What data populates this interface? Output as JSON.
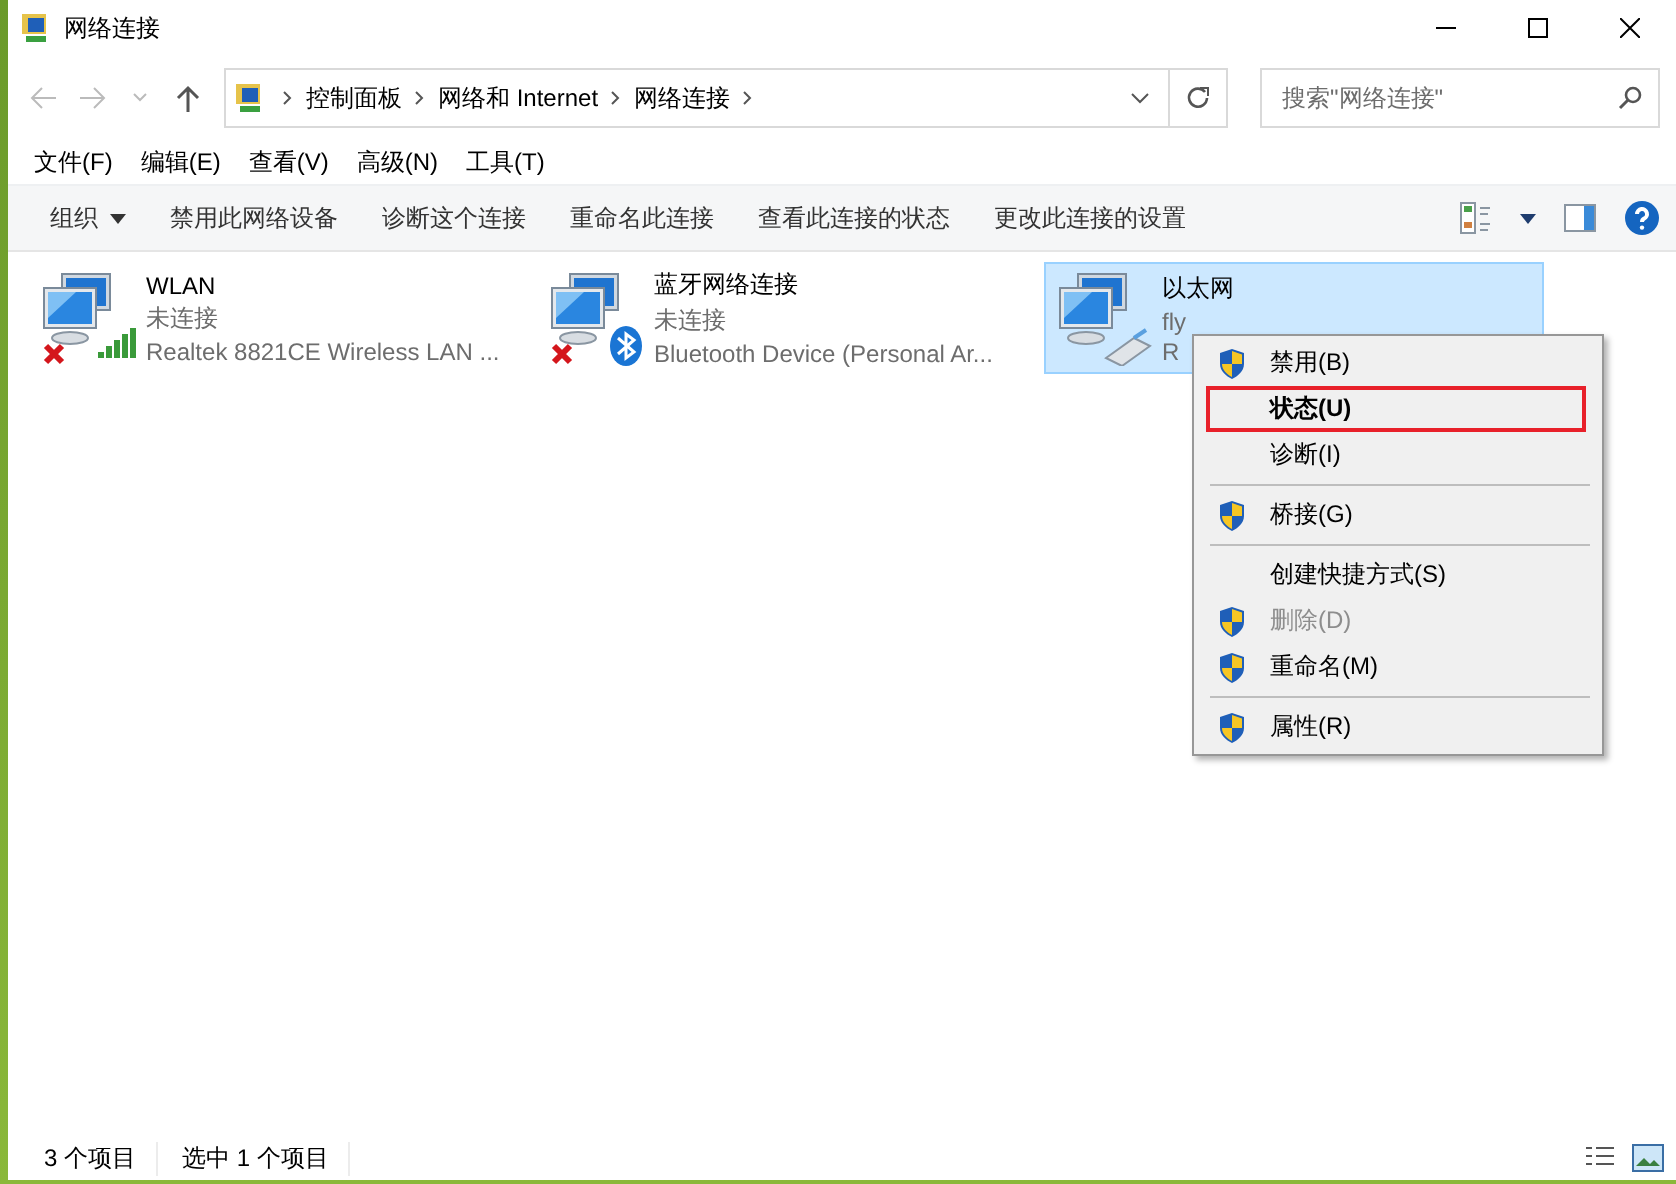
{
  "window": {
    "title": "网络连接"
  },
  "address": {
    "crumbs": [
      "控制面板",
      "网络和 Internet",
      "网络连接"
    ],
    "search_placeholder": "搜索\"网络连接\""
  },
  "menu_bar": [
    "文件(F)",
    "编辑(E)",
    "查看(V)",
    "高级(N)",
    "工具(T)"
  ],
  "toolbar": [
    {
      "label": "组织",
      "dropdown": true
    },
    {
      "label": "禁用此网络设备",
      "dropdown": false
    },
    {
      "label": "诊断这个连接",
      "dropdown": false
    },
    {
      "label": "重命名此连接",
      "dropdown": false
    },
    {
      "label": "查看此连接的状态",
      "dropdown": false
    },
    {
      "label": "更改此连接的设置",
      "dropdown": false
    }
  ],
  "connections": [
    {
      "name": "WLAN",
      "status": "未连接",
      "device": "Realtek 8821CE Wireless LAN ...",
      "kind": "wifi",
      "disconnected": true,
      "selected": false
    },
    {
      "name": "蓝牙网络连接",
      "status": "未连接",
      "device": "Bluetooth Device (Personal Ar...",
      "kind": "bluetooth",
      "disconnected": true,
      "selected": false
    },
    {
      "name": "以太网",
      "status": "fly",
      "device": "R",
      "kind": "ethernet",
      "disconnected": false,
      "selected": true
    }
  ],
  "context_menu": [
    {
      "kind": "item",
      "label": "禁用(B)",
      "shield": true,
      "bold": false,
      "disabled": false,
      "highlighted": false
    },
    {
      "kind": "item",
      "label": "状态(U)",
      "shield": false,
      "bold": true,
      "disabled": false,
      "highlighted": true
    },
    {
      "kind": "item",
      "label": "诊断(I)",
      "shield": false,
      "bold": false,
      "disabled": false,
      "highlighted": false
    },
    {
      "kind": "separator"
    },
    {
      "kind": "item",
      "label": "桥接(G)",
      "shield": true,
      "bold": false,
      "disabled": false,
      "highlighted": false
    },
    {
      "kind": "separator"
    },
    {
      "kind": "item",
      "label": "创建快捷方式(S)",
      "shield": false,
      "bold": false,
      "disabled": false,
      "highlighted": false
    },
    {
      "kind": "item",
      "label": "删除(D)",
      "shield": true,
      "bold": false,
      "disabled": true,
      "highlighted": false
    },
    {
      "kind": "item",
      "label": "重命名(M)",
      "shield": true,
      "bold": false,
      "disabled": false,
      "highlighted": false
    },
    {
      "kind": "separator"
    },
    {
      "kind": "item",
      "label": "属性(R)",
      "shield": true,
      "bold": false,
      "disabled": false,
      "highlighted": false
    }
  ],
  "status_bar": [
    "3 个项目",
    "选中 1 个项目"
  ]
}
